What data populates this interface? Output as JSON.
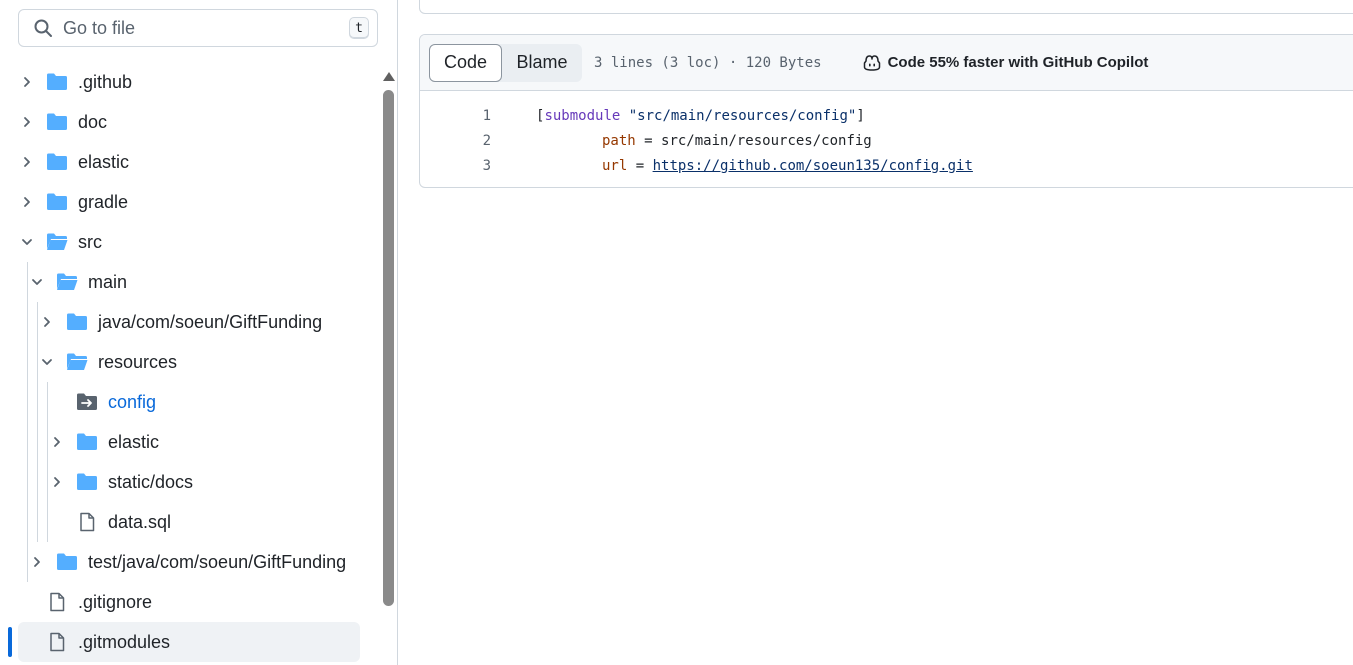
{
  "sidebar": {
    "search_placeholder": "Go to file",
    "search_shortcut": "t",
    "tree": [
      {
        "label": ".github",
        "type": "folder",
        "expanded": false
      },
      {
        "label": "doc",
        "type": "folder",
        "expanded": false
      },
      {
        "label": "elastic",
        "type": "folder",
        "expanded": false
      },
      {
        "label": "gradle",
        "type": "folder",
        "expanded": false
      },
      {
        "label": "src",
        "type": "folder",
        "expanded": true
      },
      {
        "label": "main",
        "type": "folder",
        "expanded": true
      },
      {
        "label": "java/com/soeun/GiftFunding",
        "type": "folder",
        "expanded": false
      },
      {
        "label": "resources",
        "type": "folder",
        "expanded": true
      },
      {
        "label": "config",
        "type": "submodule"
      },
      {
        "label": "elastic",
        "type": "folder",
        "expanded": false
      },
      {
        "label": "static/docs",
        "type": "folder",
        "expanded": false
      },
      {
        "label": "data.sql",
        "type": "file"
      },
      {
        "label": "test/java/com/soeun/GiftFunding",
        "type": "folder",
        "expanded": false
      },
      {
        "label": ".gitignore",
        "type": "file"
      },
      {
        "label": ".gitmodules",
        "type": "file",
        "active": true
      }
    ]
  },
  "file": {
    "tabs": {
      "code": "Code",
      "blame": "Blame"
    },
    "meta": "3 lines (3 loc) · 120 Bytes",
    "copilot": "Code 55% faster with GitHub Copilot",
    "lines": [
      {
        "num": "1",
        "open": "[",
        "kw": "submodule",
        "sp": " ",
        "str": "\"src/main/resources/config\"",
        "close": "]"
      },
      {
        "num": "2",
        "indent": "\t",
        "key": "path",
        "eq": " = ",
        "value": "src/main/resources/config"
      },
      {
        "num": "3",
        "indent": "\t",
        "key": "url",
        "eq": " = ",
        "value": "https://github.com/soeun135/config.git"
      }
    ]
  },
  "colors": {
    "folder": "#54aeff",
    "link": "#0969da",
    "border": "#d0d7de",
    "active_indicator": "#0969da"
  }
}
